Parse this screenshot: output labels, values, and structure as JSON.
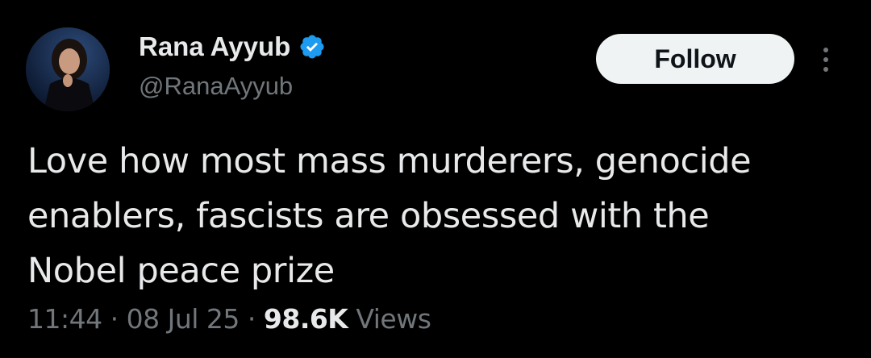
{
  "author": {
    "name": "Rana Ayyub",
    "handle": "@RanaAyyub",
    "verified_icon": "verified-badge-icon",
    "verified_color": "#1d9bf0"
  },
  "follow_button": {
    "label": "Follow"
  },
  "more_menu": {
    "icon": "more-vertical-icon"
  },
  "tweet": {
    "lines": [
      "Love how most mass murderers, genocide",
      "enablers, fascists are obsessed with the",
      "Nobel peace prize"
    ]
  },
  "meta": {
    "time": "11:44",
    "separator": "·",
    "date": "08 Jul 25",
    "views_count": "98.6K",
    "views_label": "Views"
  },
  "colors": {
    "background": "#000000",
    "text_primary": "#e7e9ea",
    "text_secondary": "#71767b",
    "button_bg": "#eff3f4",
    "button_text": "#0f1419"
  }
}
